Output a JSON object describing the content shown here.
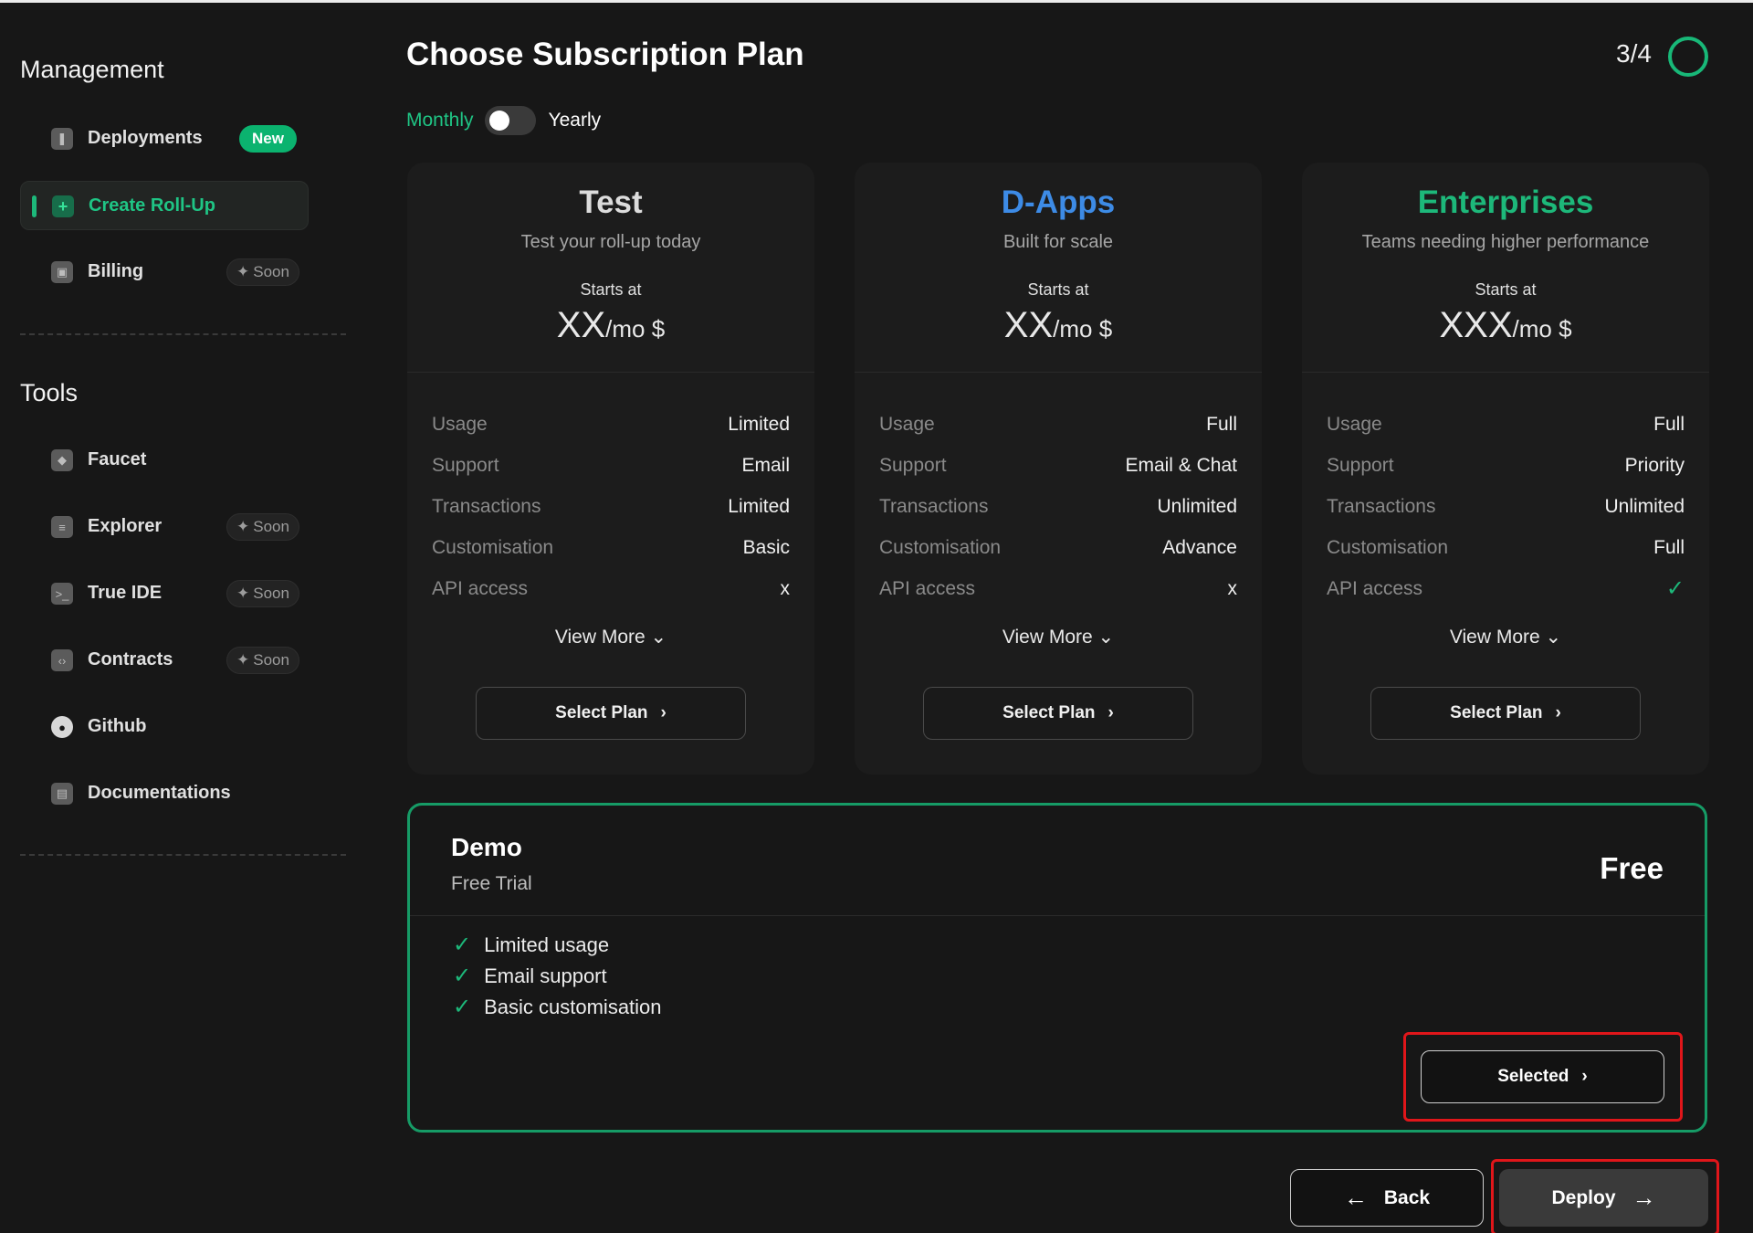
{
  "sidebar": {
    "management_title": "Management",
    "tools_title": "Tools",
    "management_items": [
      {
        "label": "Deployments",
        "badge": "New",
        "icon": "rocket-icon"
      },
      {
        "label": "Create Roll-Up",
        "badge": "",
        "icon": "plus-icon"
      },
      {
        "label": "Billing",
        "badge": "Soon",
        "icon": "wallet-icon"
      }
    ],
    "tools_items": [
      {
        "label": "Faucet",
        "badge": "",
        "icon": "cube-icon"
      },
      {
        "label": "Explorer",
        "badge": "Soon",
        "icon": "list-icon"
      },
      {
        "label": "True IDE",
        "badge": "Soon",
        "icon": "terminal-icon"
      },
      {
        "label": "Contracts",
        "badge": "Soon",
        "icon": "code-icon"
      },
      {
        "label": "Github",
        "badge": "",
        "icon": "github-icon"
      },
      {
        "label": "Documentations",
        "badge": "",
        "icon": "document-icon"
      }
    ]
  },
  "header": {
    "title": "Choose Subscription Plan",
    "step": "3/4"
  },
  "billing_toggle": {
    "left_label": "Monthly",
    "right_label": "Yearly"
  },
  "plans": [
    {
      "name": "Test",
      "subtitle": "Test your roll-up today",
      "starts_label": "Starts at",
      "price": "XX",
      "unit": "/mo $",
      "name_color": "#dcdcdc",
      "features": [
        {
          "k": "Usage",
          "v": "Limited"
        },
        {
          "k": "Support",
          "v": "Email"
        },
        {
          "k": "Transactions",
          "v": "Limited"
        },
        {
          "k": "Customisation",
          "v": "Basic"
        },
        {
          "k": "API access",
          "v": "x"
        }
      ],
      "view_more": "View More",
      "select_label": "Select Plan"
    },
    {
      "name": "D-Apps",
      "subtitle": "Built for scale",
      "starts_label": "Starts at",
      "price": "XX",
      "unit": "/mo $",
      "name_color": "#3d8be6",
      "features": [
        {
          "k": "Usage",
          "v": "Full"
        },
        {
          "k": "Support",
          "v": "Email & Chat"
        },
        {
          "k": "Transactions",
          "v": "Unlimited"
        },
        {
          "k": "Customisation",
          "v": "Advance"
        },
        {
          "k": "API access",
          "v": "x"
        }
      ],
      "view_more": "View More",
      "select_label": "Select Plan"
    },
    {
      "name": "Enterprises",
      "subtitle": "Teams needing higher performance",
      "starts_label": "Starts at",
      "price": "XXX",
      "unit": "/mo $",
      "name_color": "#1db87a",
      "features": [
        {
          "k": "Usage",
          "v": "Full"
        },
        {
          "k": "Support",
          "v": "Priority"
        },
        {
          "k": "Transactions",
          "v": "Unlimited"
        },
        {
          "k": "Customisation",
          "v": "Full"
        },
        {
          "k": "API access",
          "v": "✓"
        }
      ],
      "view_more": "View More",
      "select_label": "Select Plan"
    }
  ],
  "demo": {
    "title": "Demo",
    "subtitle": "Free Trial",
    "price": "Free",
    "features": [
      "Limited usage",
      "Email support",
      "Basic customisation"
    ],
    "selected_label": "Selected"
  },
  "footer": {
    "back_label": "Back",
    "deploy_label": "Deploy"
  },
  "colors": {
    "accent": "#1db87a",
    "d_apps": "#3d8be6",
    "highlight": "#e0161a"
  }
}
